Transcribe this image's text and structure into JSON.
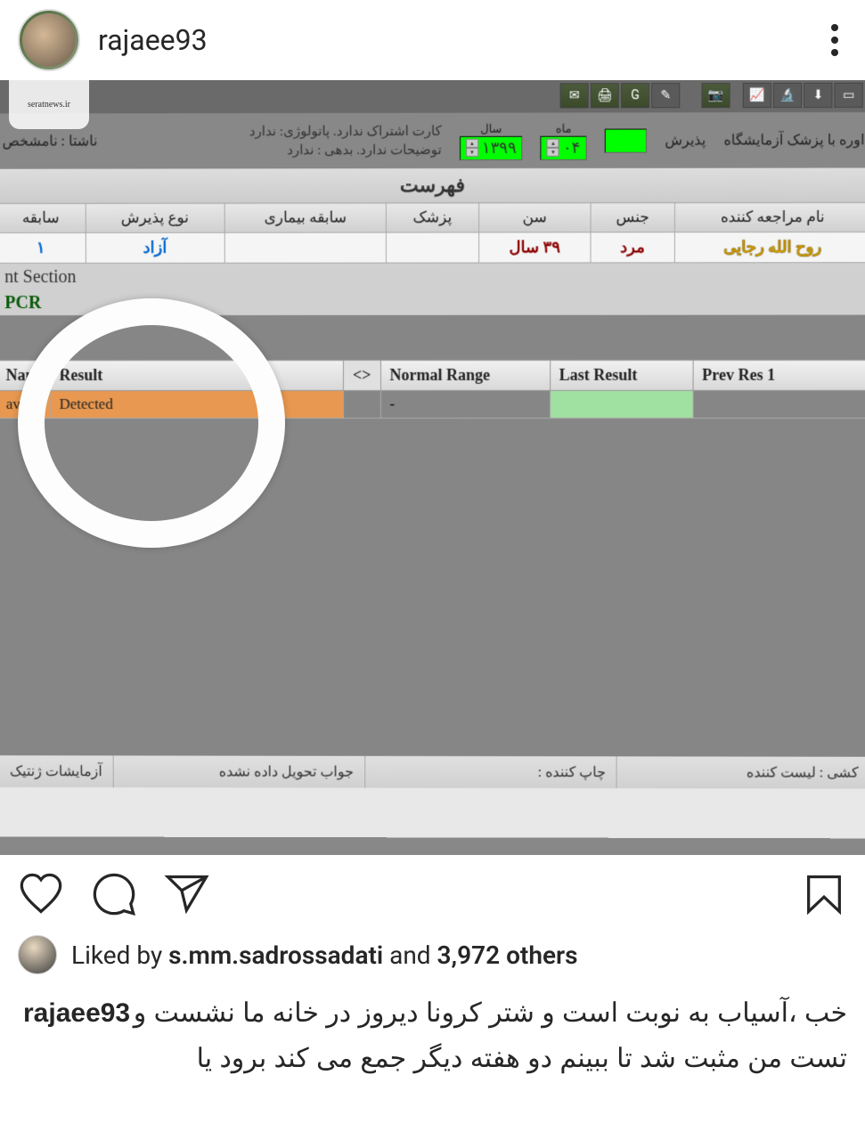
{
  "watermark": "seratnews.ir",
  "header": {
    "username": "rajaee93"
  },
  "lab": {
    "info_line1_labels": [
      "کارت اشتراک ندارد.",
      "پاتولوژی:",
      "ندارد"
    ],
    "info_line2_labels": [
      "توضیحات ندارد.",
      "بدهی :",
      "ندارد"
    ],
    "fasting_label": "ناشتا : نامشخص",
    "consult_label": "اوره با پزشک آزمایشگاه",
    "admit_label": "پذیرش",
    "month_label": "ماه",
    "year_label": "سال",
    "month_value": "۰۴",
    "year_value": "۱۳۹۹",
    "list_header": "فهرست",
    "patient_headers": {
      "name": "نام مراجعه کننده",
      "gender": "جنس",
      "age": "سن",
      "doctor": "پزشک",
      "history": "سابقه بیماری",
      "admit_type": "نوع پذیرش",
      "record": "سابقه"
    },
    "patient_values": {
      "name": "روح الله رجایی",
      "gender": "مرد",
      "age": "٣٩ سال",
      "admit_type": "آزاد",
      "record": "١"
    },
    "section_label": "nt Section",
    "pcr_label": "PCR",
    "results_headers": {
      "name": "Nam",
      "result": "Result",
      "arrow": "<>",
      "normal": "Normal Range",
      "last": "Last Result",
      "prev": "Prev Res 1"
    },
    "results_values": {
      "name": "avi",
      "result": "Detected",
      "normal": "-"
    },
    "bottom": {
      "list_entry": "کشی : لیست کننده",
      "printer": "چاپ کننده :",
      "undelivered": "جواب تحویل داده نشده",
      "genetic": "آزمایشات ژنتیک"
    }
  },
  "actions": {
    "liked_by_prefix": "Liked by ",
    "liked_by_user": "s.mm.sadrossadati",
    "liked_by_and": " and ",
    "liked_by_count": "3,972 others"
  },
  "caption": {
    "username": "rajaee93",
    "text": "خب ،آسیاب به نوبت است و شتر کرونا دیروز در خانه ما نشست و تست من مثبت شد تا ببینم دو هفته دیگر جمع می کند برود یا"
  }
}
